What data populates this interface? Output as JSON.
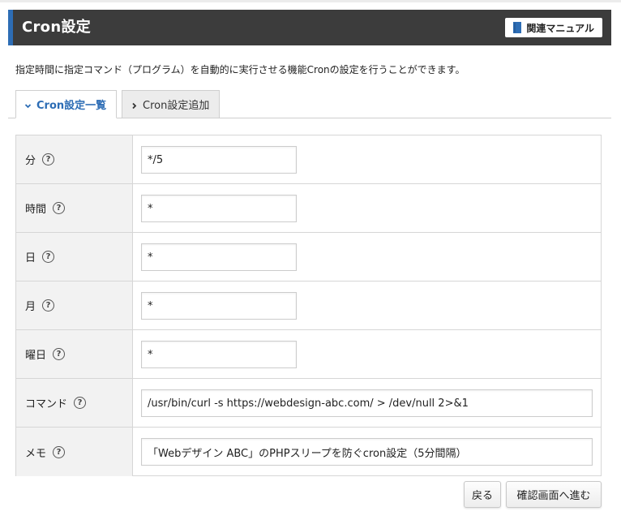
{
  "header": {
    "title": "Cron設定",
    "manual_button": "関連マニュアル",
    "accent_color": "#2d6db5"
  },
  "description": "指定時間に指定コマンド（プログラム）を自動的に実行させる機能Cronの設定を行うことができます。",
  "tabs": [
    {
      "label": "Cron設定一覧",
      "active": true
    },
    {
      "label": "Cron設定追加",
      "active": false
    }
  ],
  "form": {
    "help_symbol": "?",
    "rows": [
      {
        "label": "分",
        "value": "*/5"
      },
      {
        "label": "時間",
        "value": "*"
      },
      {
        "label": "日",
        "value": "*"
      },
      {
        "label": "月",
        "value": "*"
      },
      {
        "label": "曜日",
        "value": "*"
      },
      {
        "label": "コマンド",
        "value": "/usr/bin/curl -s https://webdesign-abc.com/ > /dev/null 2>&1"
      },
      {
        "label": "メモ",
        "value": "「Webデザイン ABC」のPHPスリープを防ぐcron設定（5分間隔）"
      }
    ]
  },
  "buttons": {
    "back": "戻る",
    "next": "確認画面へ進む"
  }
}
